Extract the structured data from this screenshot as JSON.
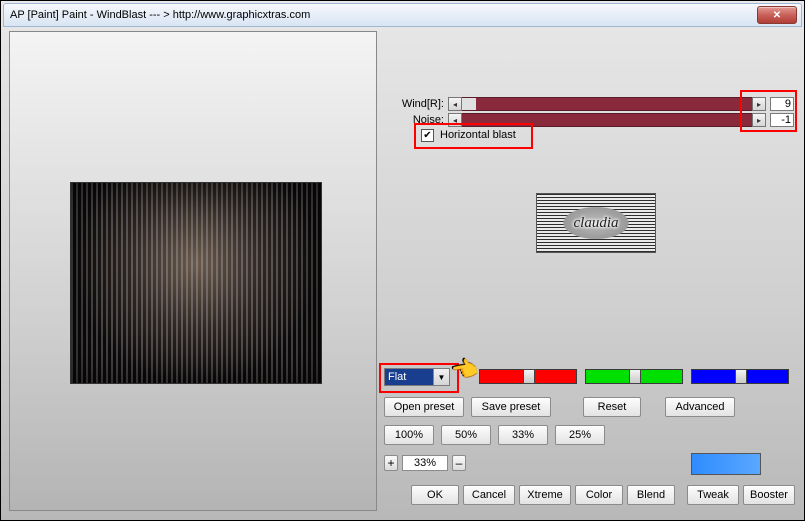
{
  "window": {
    "title": "AP [Paint]  Paint - WindBlast   --- > http://www.graphicxtras.com"
  },
  "params": {
    "wind_label": "Wind[R]:",
    "wind_value": "9",
    "noise_label": "Noise:",
    "noise_value": "-1",
    "horizontal_blast_label": "Horizontal blast",
    "horizontal_blast_checked": true
  },
  "logo_text": "claudia",
  "dropdown": {
    "selected": "Flat"
  },
  "buttons_row1": {
    "open_preset": "Open preset",
    "save_preset": "Save preset",
    "reset": "Reset",
    "advanced": "Advanced"
  },
  "buttons_row2": {
    "p100": "100%",
    "p50": "50%",
    "p33": "33%",
    "p25": "25%"
  },
  "zoom": {
    "plus": "+",
    "value": "33%",
    "minus": "–"
  },
  "buttons_row3": {
    "ok": "OK",
    "cancel": "Cancel",
    "xtreme": "Xtreme",
    "color": "Color",
    "blend": "Blend",
    "tweak": "Tweak",
    "booster": "Booster"
  },
  "close_label": "✕"
}
